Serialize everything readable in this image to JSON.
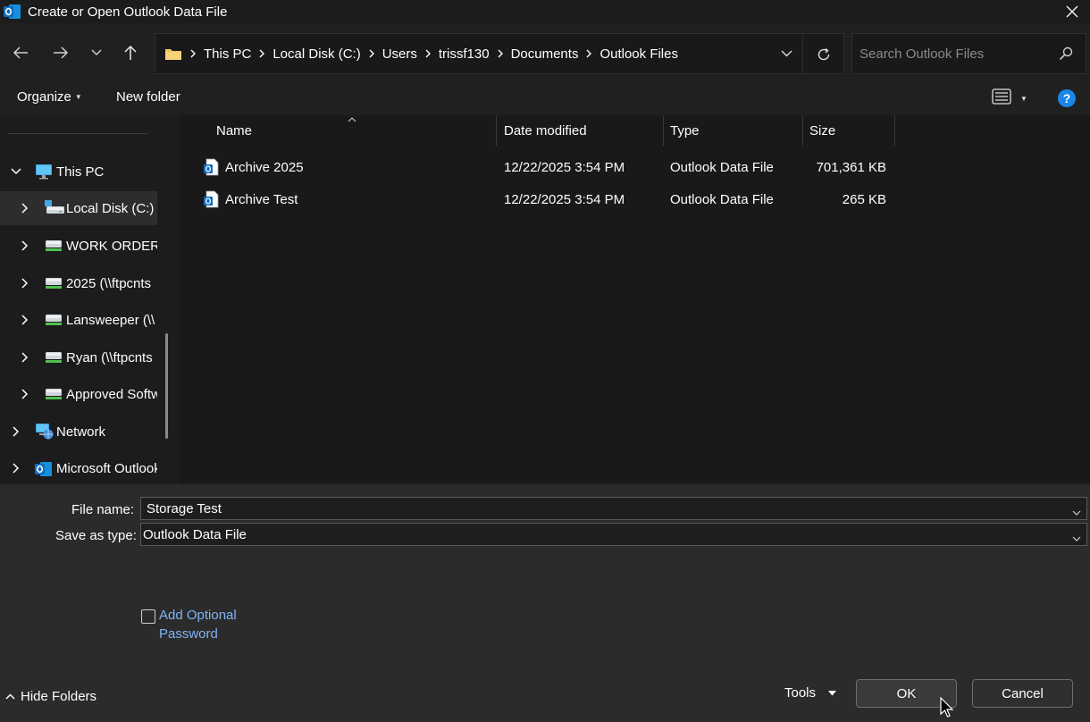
{
  "window": {
    "title": "Create or Open Outlook Data File",
    "close_icon": "close-icon",
    "app_icon": "outlook-icon"
  },
  "nav": {
    "breadcrumb": [
      "This PC",
      "Local Disk (C:)",
      "Users",
      "trissf130",
      "Documents",
      "Outlook Files"
    ],
    "search_placeholder": "Search Outlook Files"
  },
  "toolbar": {
    "organize_label": "Organize",
    "new_folder_label": "New folder"
  },
  "sidebar": {
    "items": [
      {
        "label": "This PC",
        "icon": "monitor-icon",
        "expanded": true
      },
      {
        "label": "Local Disk (C:)",
        "icon": "local-disk-icon",
        "selected": true
      },
      {
        "label": "WORK ORDERS",
        "icon": "network-drive-icon"
      },
      {
        "label": "2025 (\\\\ftpcnts",
        "icon": "network-drive-icon"
      },
      {
        "label": "Lansweeper (\\\\",
        "icon": "network-drive-icon"
      },
      {
        "label": "Ryan (\\\\ftpcnts",
        "icon": "network-drive-icon"
      },
      {
        "label": "Approved Softw",
        "icon": "network-drive-icon"
      },
      {
        "label": "Network",
        "icon": "network-icon"
      },
      {
        "label": "Microsoft Outlook",
        "icon": "outlook-icon"
      }
    ]
  },
  "files": {
    "columns": [
      "Name",
      "Date modified",
      "Type",
      "Size"
    ],
    "rows": [
      {
        "name": "Archive 2025",
        "date": "12/22/2025 3:54 PM",
        "type": "Outlook Data File",
        "size": "701,361 KB"
      },
      {
        "name": "Archive Test",
        "date": "12/22/2025 3:54 PM",
        "type": "Outlook Data File",
        "size": "265 KB"
      }
    ]
  },
  "form": {
    "file_name_label": "File name:",
    "file_name_value": "Storage Test",
    "save_type_label": "Save as type:",
    "save_type_value": "Outlook Data File",
    "password_line1": "Add Optional",
    "password_line2": "Password"
  },
  "footer": {
    "hide_folders_label": "Hide Folders",
    "tools_label": "Tools",
    "ok_label": "OK",
    "cancel_label": "Cancel"
  },
  "colors": {
    "accent": "#0078d4",
    "link": "#7fb3f5",
    "folder": "#f2c55c",
    "outlook_blue": "#0f6cbd"
  }
}
